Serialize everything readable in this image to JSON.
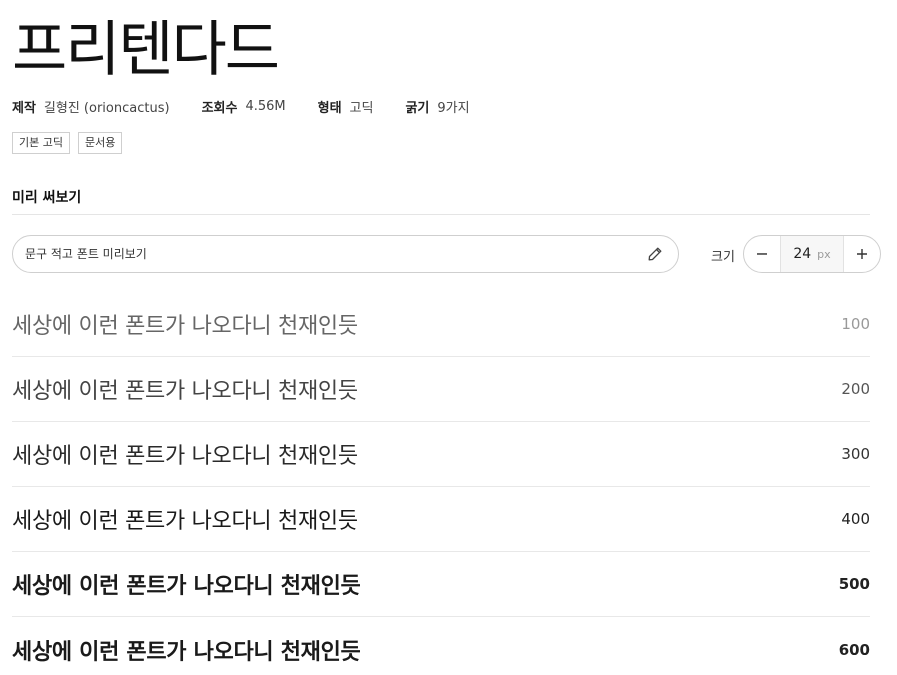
{
  "font": {
    "name": "프리텐다드",
    "meta": [
      {
        "key": "제작",
        "value": "길형진 (orioncactus)"
      },
      {
        "key": "조회수",
        "value": "4.56M"
      },
      {
        "key": "형태",
        "value": "고딕"
      },
      {
        "key": "굵기",
        "value": "9가지"
      }
    ],
    "tags": [
      "기본 고딕",
      "문서용"
    ]
  },
  "preview": {
    "heading": "미리 써보기",
    "input_placeholder": "문구 적고 폰트 미리보기",
    "input_value": "",
    "size_label": "크기",
    "size_value": "24",
    "size_unit": "px",
    "minus_icon": "minus-icon",
    "plus_icon": "plus-icon",
    "edit_icon": "pencil-icon"
  },
  "weights": [
    {
      "sample": "세상에 이런 폰트가 나오다니 천재인듯",
      "weight": "100"
    },
    {
      "sample": "세상에 이런 폰트가 나오다니 천재인듯",
      "weight": "200"
    },
    {
      "sample": "세상에 이런 폰트가 나오다니 천재인듯",
      "weight": "300"
    },
    {
      "sample": "세상에 이런 폰트가 나오다니 천재인듯",
      "weight": "400"
    },
    {
      "sample": "세상에 이런 폰트가 나오다니 천재인듯",
      "weight": "500"
    },
    {
      "sample": "세상에 이런 폰트가 나오다니 천재인듯",
      "weight": "600"
    }
  ]
}
